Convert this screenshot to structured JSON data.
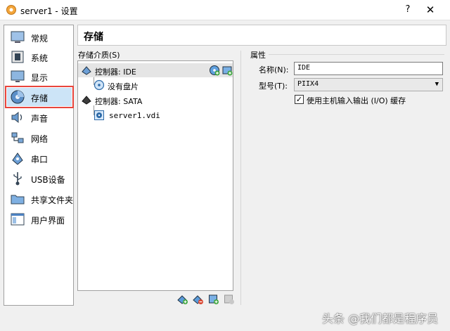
{
  "window": {
    "title": "server1 - 设置",
    "help_symbol": "?",
    "close_symbol": "✕"
  },
  "sidebar": {
    "items": [
      {
        "label": "常规",
        "icon": "general-icon"
      },
      {
        "label": "系统",
        "icon": "system-icon"
      },
      {
        "label": "显示",
        "icon": "display-icon"
      },
      {
        "label": "存储",
        "icon": "storage-icon",
        "selected": true
      },
      {
        "label": "声音",
        "icon": "sound-icon"
      },
      {
        "label": "网络",
        "icon": "network-icon"
      },
      {
        "label": "串口",
        "icon": "serial-port-icon"
      },
      {
        "label": "USB设备",
        "icon": "usb-icon"
      },
      {
        "label": "共享文件夹",
        "icon": "shared-folder-icon"
      },
      {
        "label": "用户界面",
        "icon": "user-interface-icon"
      }
    ]
  },
  "page": {
    "header": "存储"
  },
  "storage_tree": {
    "label": "存储介质(S)",
    "controllers": [
      {
        "name": "控制器: IDE",
        "children": [
          "没有盘片"
        ]
      },
      {
        "name": "控制器: SATA",
        "children": [
          "server1.vdi"
        ]
      }
    ]
  },
  "attributes": {
    "section_label": "属性",
    "name_label": "名称(N):",
    "name_value": "IDE",
    "type_label": "型号(T):",
    "type_value": "PIIX4",
    "use_host_io_label": "使用主机输入输出 (I/O) 缓存",
    "use_host_io_checked": true
  },
  "watermark": "头条 @我们都是程序员",
  "colors": {
    "accent_red": "#e8453c",
    "selection": "#cce4f7"
  }
}
